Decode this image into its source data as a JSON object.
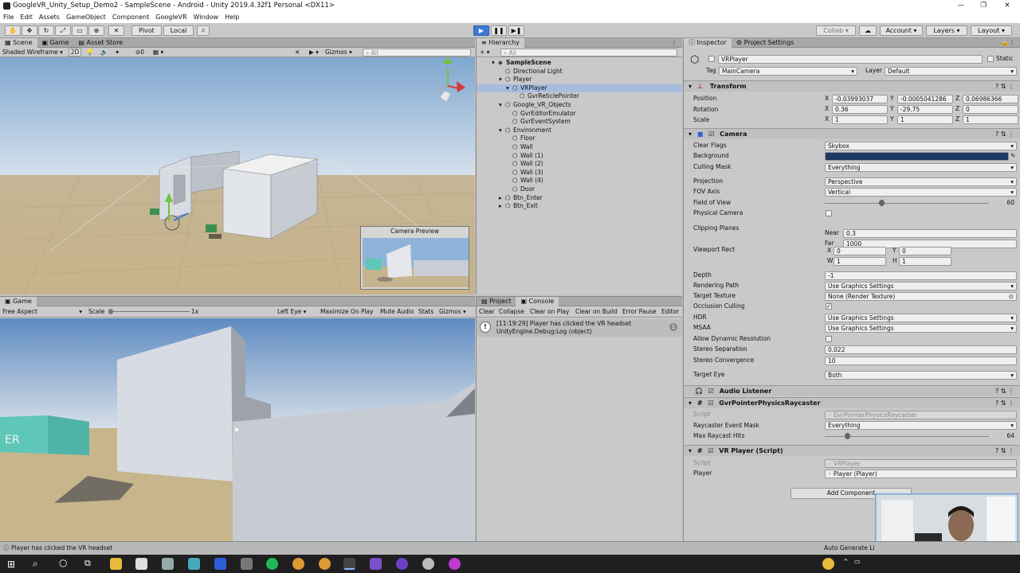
{
  "window": {
    "title": "GoogleVR_Unity_Setup_Demo2 - SampleScene - Android - Unity 2019.4.32f1 Personal <DX11>"
  },
  "menu": [
    "File",
    "Edit",
    "Assets",
    "GameObject",
    "Component",
    "GoogleVR",
    "Window",
    "Help"
  ],
  "toolbar": {
    "pivot": "Pivot",
    "local": "Local",
    "collab": "Collab",
    "account": "Account",
    "layers": "Layers",
    "layout": "Layout"
  },
  "scene": {
    "tabs": [
      "Scene",
      "Game",
      "Asset Store"
    ],
    "shading": "Shaded Wireframe",
    "mode2d": "2D",
    "fx_count": "0",
    "gizmos": "Gizmos",
    "search": "All",
    "camera_preview_title": "Camera Preview"
  },
  "game": {
    "tab": "Game",
    "aspect": "Free Aspect",
    "scale_label": "Scale",
    "scale_value": "1x",
    "eye": "Left Eye",
    "maximize": "Maximize On Play",
    "mute": "Mute Audio",
    "stats": "Stats",
    "gizmos": "Gizmos",
    "cube_text": "ER"
  },
  "hierarchy": {
    "tab": "Hierarchy",
    "add": "+",
    "search": "All",
    "items": [
      {
        "label": "SampleScene",
        "bold": true
      },
      {
        "label": "Directional Light"
      },
      {
        "label": "Player"
      },
      {
        "label": "VRPlayer",
        "selected": true
      },
      {
        "label": "GvrReticlePointer"
      },
      {
        "label": "Google_VR_Objects"
      },
      {
        "label": "GvrEditorEmulator"
      },
      {
        "label": "GvrEventSystem"
      },
      {
        "label": "Environment"
      },
      {
        "label": "Floor"
      },
      {
        "label": "Wall"
      },
      {
        "label": "Wall (1)"
      },
      {
        "label": "Wall (2)"
      },
      {
        "label": "Wall (3)"
      },
      {
        "label": "Wall (4)"
      },
      {
        "label": "Door"
      },
      {
        "label": "Btn_Enter"
      },
      {
        "label": "Btn_Exit"
      }
    ]
  },
  "console": {
    "tabs": [
      "Project",
      "Console"
    ],
    "buttons": [
      "Clear",
      "Collapse",
      "Clear on Play",
      "Clear on Build",
      "Error Pause",
      "Editor"
    ],
    "message_line1": "[11:19:29] Player has clicked the VR headset",
    "message_line2": "UnityEngine.Debug:Log (object)",
    "count": "1"
  },
  "inspector": {
    "tabs": [
      "Inspector",
      "Project Settings"
    ],
    "object_name": "VRPlayer",
    "static": "Static",
    "tag_label": "Tag",
    "tag_value": "MainCamera",
    "layer_label": "Layer",
    "layer_value": "Default",
    "transform": {
      "header": "Transform",
      "position_label": "Position",
      "rotation_label": "Rotation",
      "scale_label": "Scale",
      "position": [
        "-0.03993037",
        "-0.0005041286",
        "0.06986366"
      ],
      "rotation": [
        "0.36",
        "-29.75",
        "0"
      ],
      "scale": [
        "1",
        "1",
        "1"
      ]
    },
    "camera": {
      "header": "Camera",
      "clear_flags_label": "Clear Flags",
      "clear_flags": "Skybox",
      "background_label": "Background",
      "background_color": "#1c3a63",
      "culling_mask_label": "Culling Mask",
      "culling_mask": "Everything",
      "projection_label": "Projection",
      "projection": "Perspective",
      "fov_axis_label": "FOV Axis",
      "fov_axis": "Vertical",
      "fov_label": "Field of View",
      "fov": "60",
      "fov_slider_fraction": 0.33,
      "physical_label": "Physical Camera",
      "clipping_label": "Clipping Planes",
      "near_label": "Near",
      "near": "0.3",
      "far_label": "Far",
      "far": "1000",
      "viewport_label": "Viewport Rect",
      "vp_x": "0",
      "vp_y": "0",
      "vp_w": "1",
      "vp_h": "1",
      "depth_label": "Depth",
      "depth": "-1",
      "rendering_path_label": "Rendering Path",
      "rendering_path": "Use Graphics Settings",
      "target_texture_label": "Target Texture",
      "target_texture": "None (Render Texture)",
      "occlusion_label": "Occlusion Culling",
      "hdr_label": "HDR",
      "hdr": "Use Graphics Settings",
      "msaa_label": "MSAA",
      "msaa": "Use Graphics Settings",
      "dynres_label": "Allow Dynamic Resolution",
      "stereo_sep_label": "Stereo Separation",
      "stereo_sep": "0.022",
      "stereo_conv_label": "Stereo Convergence",
      "stereo_conv": "10",
      "target_eye_label": "Target Eye",
      "target_eye": "Both"
    },
    "audio_listener": "Audio Listener",
    "raycaster": {
      "header": "GvrPointerPhysicsRaycaster",
      "script_label": "Script",
      "script": "GvrPointerPhysicsRaycaster",
      "mask_label": "Raycaster Event Mask",
      "mask": "Everything",
      "hits_label": "Max Raycast Hits",
      "hits": "64",
      "hits_slider_fraction": 0.12
    },
    "vrplayer": {
      "header": "VR Player (Script)",
      "script_label": "Script",
      "script": "VRPlayer",
      "player_label": "Player",
      "player": "Player (Player)"
    },
    "add_component": "Add Component"
  },
  "status": {
    "message": "Player has clicked the VR headset",
    "right": "Auto Generate Li"
  }
}
